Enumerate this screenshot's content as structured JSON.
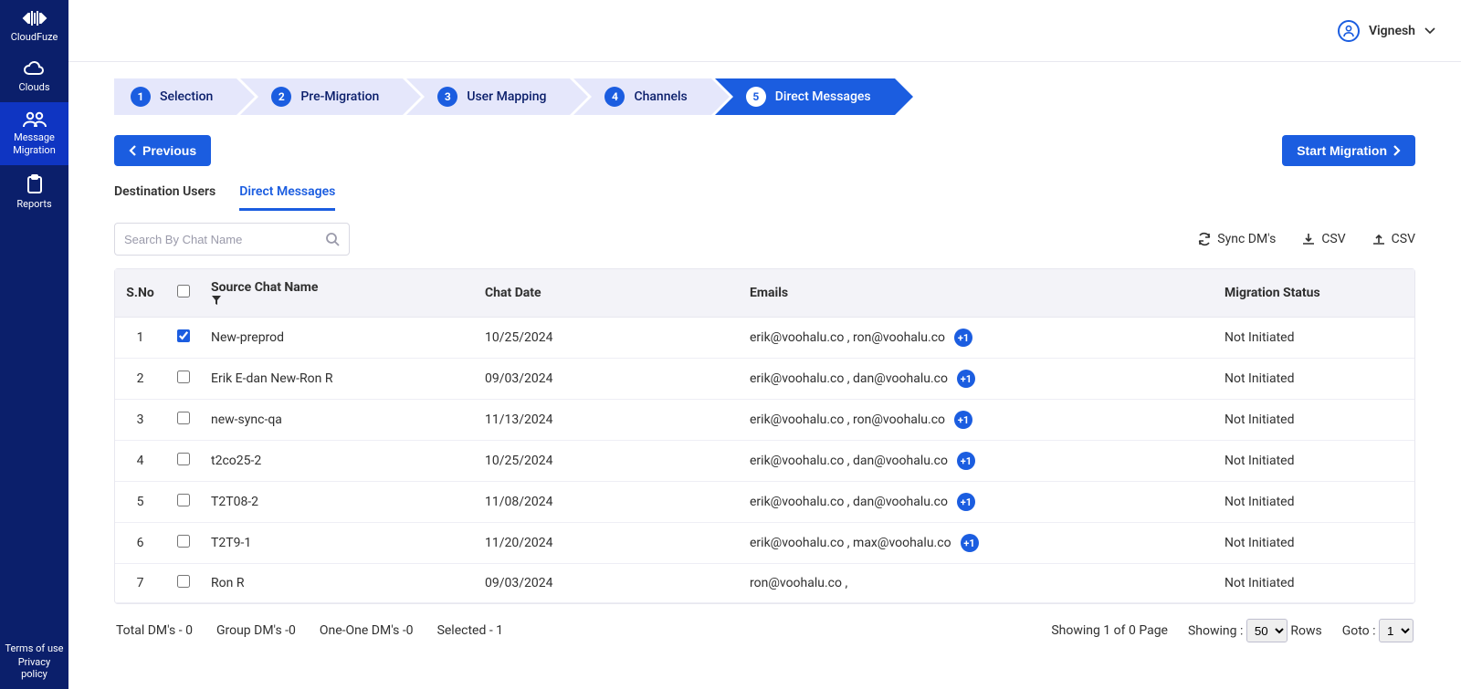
{
  "sidebar": {
    "brand": "CloudFuze",
    "items": [
      {
        "label": "Clouds"
      },
      {
        "label": "Message Migration"
      },
      {
        "label": "Reports"
      }
    ],
    "footer": {
      "terms": "Terms of use",
      "privacy": "Privacy policy"
    }
  },
  "header": {
    "user_name": "Vignesh"
  },
  "wizard": {
    "steps": [
      {
        "num": "1",
        "label": "Selection"
      },
      {
        "num": "2",
        "label": "Pre-Migration"
      },
      {
        "num": "3",
        "label": "User Mapping"
      },
      {
        "num": "4",
        "label": "Channels"
      },
      {
        "num": "5",
        "label": "Direct Messages"
      }
    ],
    "active_index": 4
  },
  "buttons": {
    "previous": "Previous",
    "start_migration": "Start Migration"
  },
  "tabs": {
    "destination_users": "Destination Users",
    "direct_messages": "Direct Messages"
  },
  "search": {
    "placeholder": "Search By Chat Name"
  },
  "tool_links": {
    "sync": "Sync DM's",
    "csv_down": "CSV",
    "csv_up": "CSV"
  },
  "table": {
    "headers": {
      "sno": "S.No",
      "chat": "Source Chat Name",
      "date": "Chat Date",
      "emails": "Emails",
      "status": "Migration Status"
    },
    "rows": [
      {
        "sno": "1",
        "checked": true,
        "chat": "New-preprod",
        "date": "10/25/2024",
        "emails": "erik@voohalu.co , ron@voohalu.co",
        "more": "+1",
        "status": "Not Initiated"
      },
      {
        "sno": "2",
        "checked": false,
        "chat": "Erik E-dan New-Ron R",
        "date": "09/03/2024",
        "emails": "erik@voohalu.co , dan@voohalu.co",
        "more": "+1",
        "status": "Not Initiated"
      },
      {
        "sno": "3",
        "checked": false,
        "chat": "new-sync-qa",
        "date": "11/13/2024",
        "emails": "erik@voohalu.co , ron@voohalu.co",
        "more": "+1",
        "status": "Not Initiated"
      },
      {
        "sno": "4",
        "checked": false,
        "chat": "t2co25-2",
        "date": "10/25/2024",
        "emails": "erik@voohalu.co , dan@voohalu.co",
        "more": "+1",
        "status": "Not Initiated"
      },
      {
        "sno": "5",
        "checked": false,
        "chat": "T2T08-2",
        "date": "11/08/2024",
        "emails": "erik@voohalu.co , dan@voohalu.co",
        "more": "+1",
        "status": "Not Initiated"
      },
      {
        "sno": "6",
        "checked": false,
        "chat": "T2T9-1",
        "date": "11/20/2024",
        "emails": "erik@voohalu.co , max@voohalu.co",
        "more": "+1",
        "status": "Not Initiated"
      },
      {
        "sno": "7",
        "checked": false,
        "chat": "Ron R",
        "date": "09/03/2024",
        "emails": "ron@voohalu.co ,",
        "more": "",
        "status": "Not Initiated"
      }
    ]
  },
  "footer": {
    "total_dms": "Total DM's - 0",
    "group_dms": "Group DM's -0",
    "one_one": "One-One DM's -0",
    "selected": "Selected - 1",
    "showing_page": "Showing 1 of 0 Page",
    "showing_label": "Showing :",
    "rows_value": "50",
    "rows_label": "Rows",
    "goto_label": "Goto :",
    "goto_value": "1"
  }
}
